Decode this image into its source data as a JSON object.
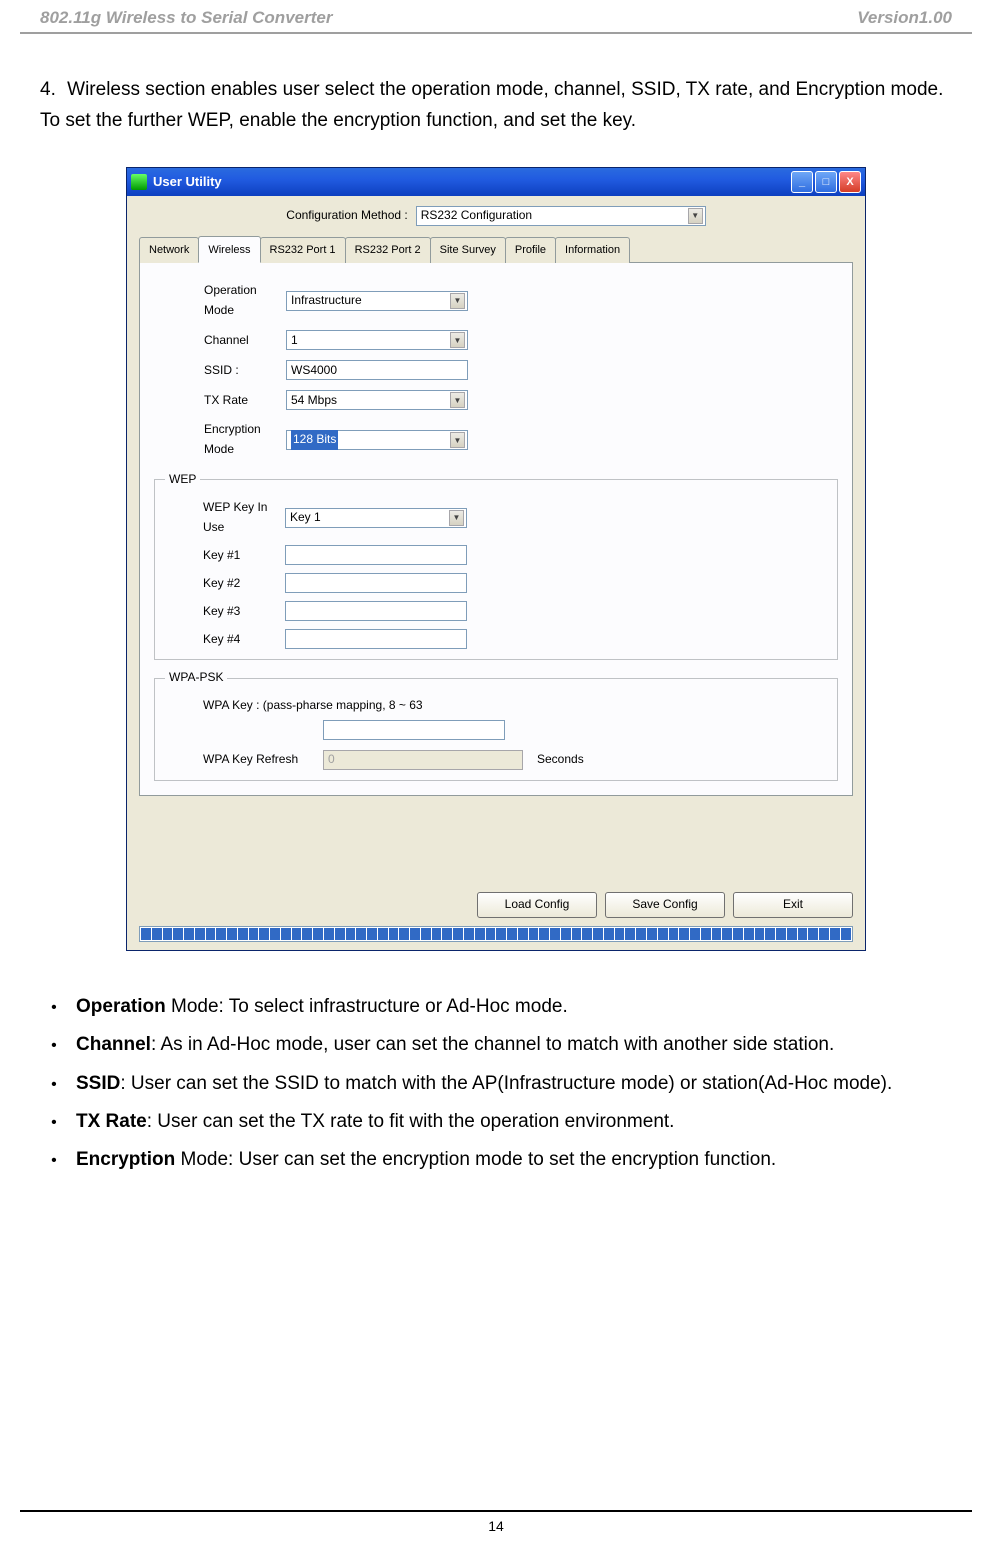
{
  "header": {
    "left": "802.11g Wireless to Serial Converter",
    "right": "Version1.00"
  },
  "step": {
    "number": "4.",
    "text": "Wireless section enables user select the operation mode, channel, SSID, TX rate, and Encryption mode. To set the further WEP, enable the encryption function, and set the key."
  },
  "window": {
    "title": "User Utility",
    "config_label": "Configuration Method :",
    "config_value": "RS232 Configuration",
    "tabs": [
      "Network",
      "Wireless",
      "RS232 Port 1",
      "RS232 Port 2",
      "Site Survey",
      "Profile",
      "Information"
    ],
    "active_tab": "Wireless",
    "fields": {
      "operation_mode_label": "Operation Mode",
      "operation_mode_value": "Infrastructure",
      "channel_label": "Channel",
      "channel_value": "1",
      "ssid_label": "SSID :",
      "ssid_value": "WS4000",
      "tx_rate_label": "TX Rate",
      "tx_rate_value": "54 Mbps",
      "encryption_label": "Encryption Mode",
      "encryption_value": "128 Bits"
    },
    "wep": {
      "legend": "WEP",
      "key_in_use_label": "WEP Key In Use",
      "key_in_use_value": "Key 1",
      "key1_label": "Key #1",
      "key2_label": "Key #2",
      "key3_label": "Key #3",
      "key4_label": "Key #4"
    },
    "wpa": {
      "legend": "WPA-PSK",
      "key_label": "WPA Key : (pass-pharse mapping, 8 ~ 63",
      "refresh_label": "WPA Key Refresh",
      "refresh_value": "0",
      "refresh_unit": "Seconds"
    },
    "buttons": {
      "load": "Load Config",
      "save": "Save Config",
      "exit": "Exit"
    }
  },
  "bullets": [
    {
      "bold": "Operation",
      "rest": " Mode: To select infrastructure or Ad-Hoc mode."
    },
    {
      "bold": "Channel",
      "rest": ": As in Ad-Hoc mode, user can set the channel to match with another side station."
    },
    {
      "bold": "SSID",
      "rest": ": User can set the SSID to match with the AP(Infrastructure mode) or station(Ad-Hoc mode)."
    },
    {
      "bold": "TX Rate",
      "rest": ": User can set the TX rate to fit with the operation environment."
    },
    {
      "bold": "Encryption",
      "rest": " Mode: User can set the encryption mode to set the encryption function."
    }
  ],
  "page_number": "14"
}
